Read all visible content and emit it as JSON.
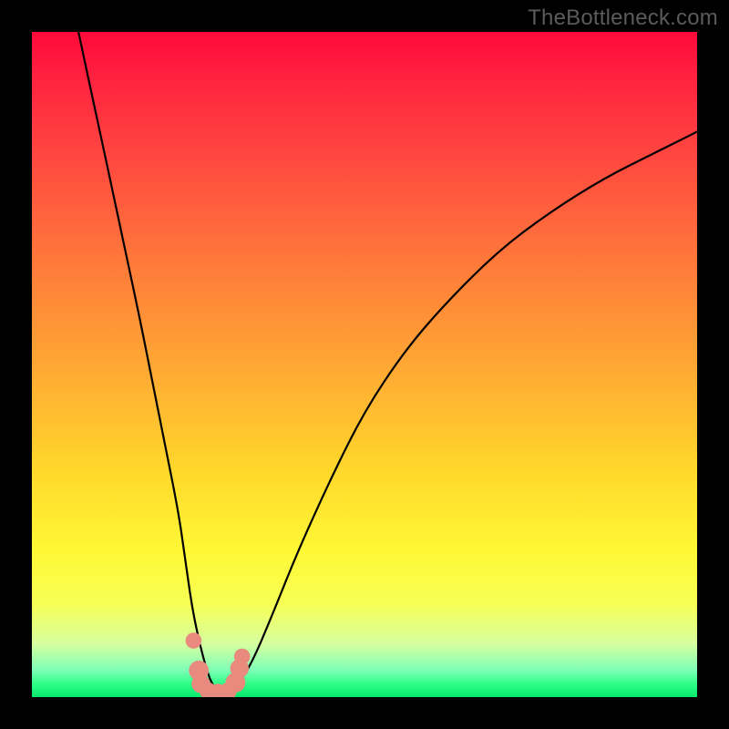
{
  "watermark": "TheBottleneck.com",
  "chart_data": {
    "type": "line",
    "title": "",
    "xlabel": "",
    "ylabel": "",
    "xlim": [
      0,
      100
    ],
    "ylim": [
      0,
      100
    ],
    "grid": false,
    "note": "Axes have no visible tick labels; x/y expressed as 0–100 relative units. Curve values estimated from pixel positions.",
    "series": [
      {
        "name": "bottleneck-curve",
        "x": [
          7,
          10,
          13,
          16,
          18,
          20,
          22,
          23,
          24,
          25,
          26,
          27,
          28,
          29,
          30,
          31,
          33,
          36,
          40,
          45,
          50,
          56,
          62,
          70,
          78,
          86,
          94,
          100
        ],
        "y": [
          100,
          86,
          72,
          58,
          48,
          38,
          28,
          21,
          14,
          9,
          5,
          2,
          1,
          1,
          1,
          2,
          5,
          12,
          22,
          33,
          43,
          52,
          59,
          67,
          73,
          78,
          82,
          85
        ]
      }
    ],
    "markers": {
      "name": "highlight-dots",
      "color": "#e98a7f",
      "points": [
        {
          "x": 24.3,
          "y": 8.5,
          "r": 1.2
        },
        {
          "x": 25.1,
          "y": 4.0,
          "r": 1.5
        },
        {
          "x": 25.4,
          "y": 2.0,
          "r": 1.4
        },
        {
          "x": 26.5,
          "y": 0.9,
          "r": 1.3
        },
        {
          "x": 28.0,
          "y": 0.8,
          "r": 1.2
        },
        {
          "x": 29.5,
          "y": 0.9,
          "r": 1.3
        },
        {
          "x": 30.6,
          "y": 2.2,
          "r": 1.5
        },
        {
          "x": 31.2,
          "y": 4.3,
          "r": 1.4
        },
        {
          "x": 31.6,
          "y": 6.1,
          "r": 1.2
        }
      ]
    },
    "background_gradient": {
      "top": "#ff0a3a",
      "mid": "#ffd82b",
      "bottom": "#05e86c"
    }
  }
}
